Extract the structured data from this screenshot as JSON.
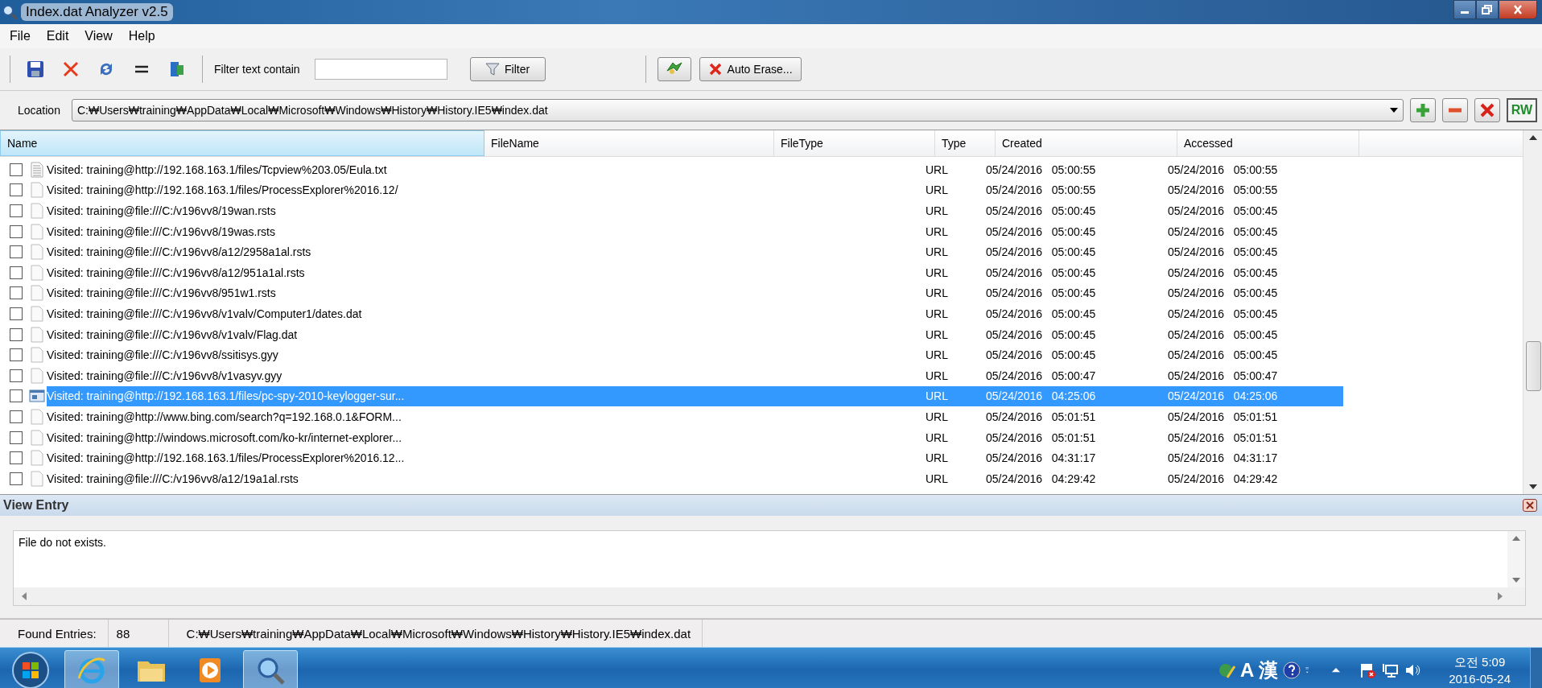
{
  "window": {
    "title": "Index.dat Analyzer v2.5"
  },
  "menu": [
    "File",
    "Edit",
    "View",
    "Help"
  ],
  "toolbar": {
    "filter_label": "Filter text contain",
    "filter_button": "Filter",
    "auto_erase_button": "Auto Erase..."
  },
  "location": {
    "label": "Location",
    "value": "C:₩Users₩training₩AppData₩Local₩Microsoft₩Windows₩History₩History.IE5₩index.dat",
    "rw_button": "RW"
  },
  "table": {
    "columns": [
      "Name",
      "FileName",
      "FileType",
      "Type",
      "Created",
      "Accessed"
    ],
    "rows": [
      {
        "kind": "text",
        "checked": false,
        "selected": false,
        "name": "Visited: training@http://192.168.163.1/files/Tcpview%203.05/Eula.txt",
        "type": "URL",
        "created": "05/24/2016   05:00:55",
        "accessed": "05/24/2016   05:00:55"
      },
      {
        "kind": "blank",
        "checked": false,
        "selected": false,
        "name": "Visited: training@http://192.168.163.1/files/ProcessExplorer%2016.12/",
        "type": "URL",
        "created": "05/24/2016   05:00:55",
        "accessed": "05/24/2016   05:00:55"
      },
      {
        "kind": "blank",
        "checked": false,
        "selected": false,
        "name": "Visited: training@file:///C:/v196vv8/19wan.rsts",
        "type": "URL",
        "created": "05/24/2016   05:00:45",
        "accessed": "05/24/2016   05:00:45"
      },
      {
        "kind": "blank",
        "checked": false,
        "selected": false,
        "name": "Visited: training@file:///C:/v196vv8/19was.rsts",
        "type": "URL",
        "created": "05/24/2016   05:00:45",
        "accessed": "05/24/2016   05:00:45"
      },
      {
        "kind": "blank",
        "checked": false,
        "selected": false,
        "name": "Visited: training@file:///C:/v196vv8/a12/2958a1al.rsts",
        "type": "URL",
        "created": "05/24/2016   05:00:45",
        "accessed": "05/24/2016   05:00:45"
      },
      {
        "kind": "blank",
        "checked": false,
        "selected": false,
        "name": "Visited: training@file:///C:/v196vv8/a12/951a1al.rsts",
        "type": "URL",
        "created": "05/24/2016   05:00:45",
        "accessed": "05/24/2016   05:00:45"
      },
      {
        "kind": "blank",
        "checked": false,
        "selected": false,
        "name": "Visited: training@file:///C:/v196vv8/951w1.rsts",
        "type": "URL",
        "created": "05/24/2016   05:00:45",
        "accessed": "05/24/2016   05:00:45"
      },
      {
        "kind": "blank",
        "checked": false,
        "selected": false,
        "name": "Visited: training@file:///C:/v196vv8/v1valv/Computer1/dates.dat",
        "type": "URL",
        "created": "05/24/2016   05:00:45",
        "accessed": "05/24/2016   05:00:45"
      },
      {
        "kind": "blank",
        "checked": false,
        "selected": false,
        "name": "Visited: training@file:///C:/v196vv8/v1valv/Flag.dat",
        "type": "URL",
        "created": "05/24/2016   05:00:45",
        "accessed": "05/24/2016   05:00:45"
      },
      {
        "kind": "blank",
        "checked": false,
        "selected": false,
        "name": "Visited: training@file:///C:/v196vv8/ssitisys.gyy",
        "type": "URL",
        "created": "05/24/2016   05:00:45",
        "accessed": "05/24/2016   05:00:45"
      },
      {
        "kind": "blank",
        "checked": false,
        "selected": false,
        "name": "Visited: training@file:///C:/v196vv8/v1vasyv.gyy",
        "type": "URL",
        "created": "05/24/2016   05:00:47",
        "accessed": "05/24/2016   05:00:47"
      },
      {
        "kind": "app",
        "checked": false,
        "selected": true,
        "name": "Visited: training@http://192.168.163.1/files/pc-spy-2010-keylogger-sur...",
        "type": "URL",
        "created": "05/24/2016   04:25:06",
        "accessed": "05/24/2016   04:25:06"
      },
      {
        "kind": "blank",
        "checked": false,
        "selected": false,
        "name": "Visited: training@http://www.bing.com/search?q=192.168.0.1&FORM...",
        "type": "URL",
        "created": "05/24/2016   05:01:51",
        "accessed": "05/24/2016   05:01:51"
      },
      {
        "kind": "blank",
        "checked": false,
        "selected": false,
        "name": "Visited: training@http://windows.microsoft.com/ko-kr/internet-explorer...",
        "type": "URL",
        "created": "05/24/2016   05:01:51",
        "accessed": "05/24/2016   05:01:51"
      },
      {
        "kind": "blank",
        "checked": false,
        "selected": false,
        "name": "Visited: training@http://192.168.163.1/files/ProcessExplorer%2016.12...",
        "type": "URL",
        "created": "05/24/2016   04:31:17",
        "accessed": "05/24/2016   04:31:17"
      },
      {
        "kind": "blank",
        "checked": false,
        "selected": false,
        "name": "Visited: training@file:///C:/v196vv8/a12/19a1al.rsts",
        "type": "URL",
        "created": "05/24/2016   04:29:42",
        "accessed": "05/24/2016   04:29:42"
      }
    ]
  },
  "view_entry": {
    "title": "View Entry",
    "text": "File do not exists."
  },
  "status_bar": {
    "label": "Found Entries:",
    "count": "88",
    "path": "C:₩Users₩training₩AppData₩Local₩Microsoft₩Windows₩History₩History.IE5₩index.dat"
  },
  "taskbar": {
    "ime_mode": "A",
    "ime_hanja": "漢",
    "clock_time": "오전 5:09",
    "clock_date": "2016-05-24"
  }
}
